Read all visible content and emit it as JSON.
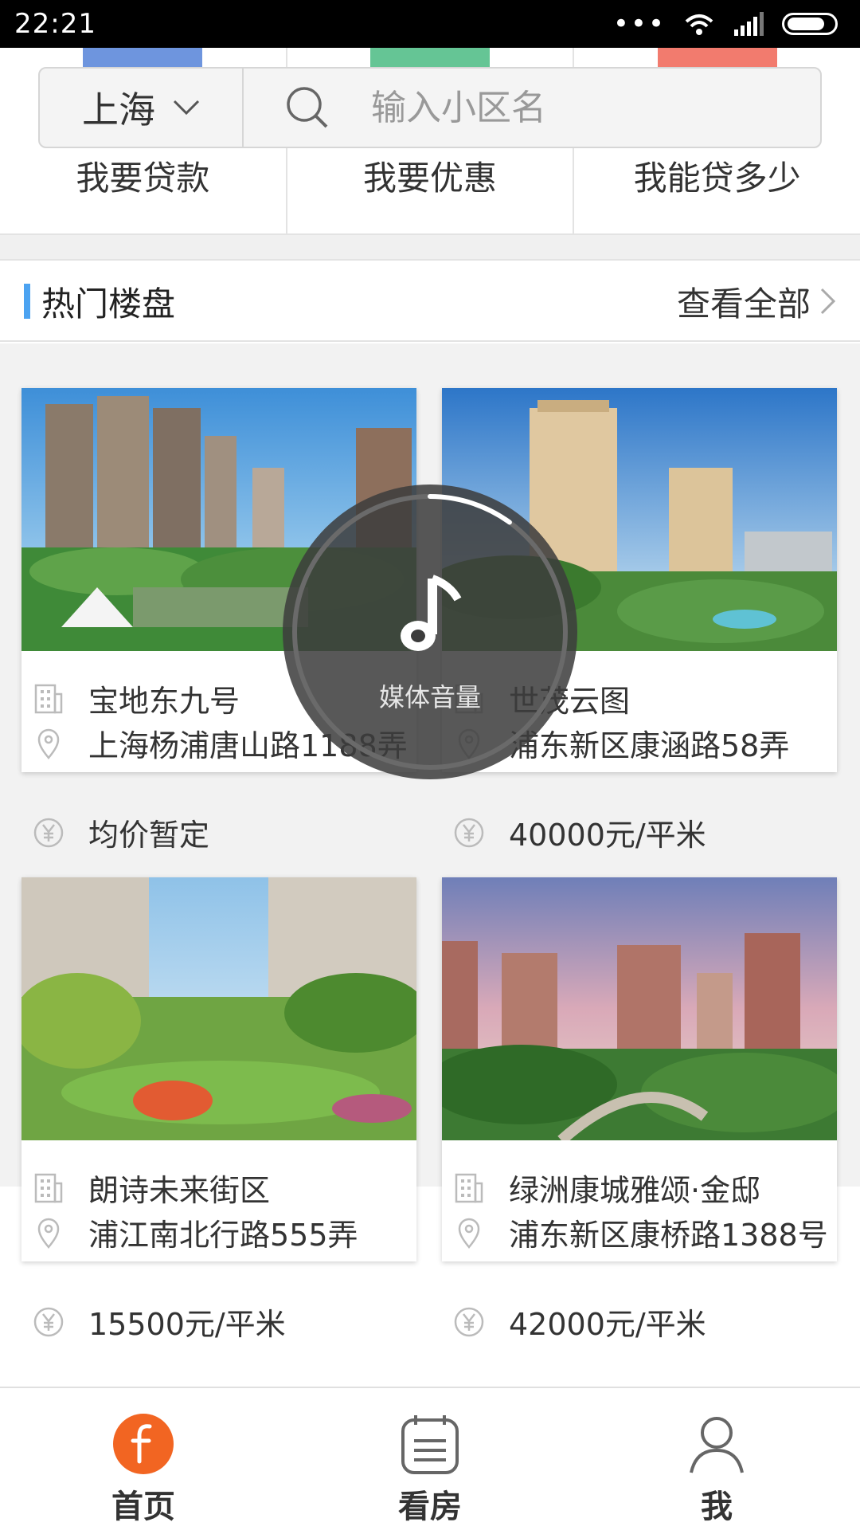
{
  "status_bar": {
    "time": "22:21",
    "dots": "•••"
  },
  "search": {
    "city": "上海",
    "placeholder": "输入小区名"
  },
  "features": [
    {
      "label": "我要贷款"
    },
    {
      "label": "我要优惠"
    },
    {
      "label": "我能贷多少"
    }
  ],
  "section": {
    "title": "热门楼盘",
    "view_all": "查看全部"
  },
  "listings": [
    {
      "name": "宝地东九号",
      "address": "上海杨浦唐山路1188弄",
      "price": "均价暂定"
    },
    {
      "name": "世茂云图",
      "address": "浦东新区康涵路58弄",
      "price": "40000元/平米"
    },
    {
      "name": "朗诗未来街区",
      "address": "浦江南北行路555弄",
      "price": "15500元/平米"
    },
    {
      "name": "绿洲康城雅颂·金邸",
      "address": "浦东新区康桥路1388号",
      "price": "42000元/平米"
    }
  ],
  "nav": [
    {
      "label": "首页",
      "icon": "home-logo-icon",
      "active": true
    },
    {
      "label": "看房",
      "icon": "calendar-list-icon"
    },
    {
      "label": "我",
      "icon": "user-icon"
    }
  ],
  "volume_overlay": {
    "label": "媒体音量",
    "level": 0.1
  },
  "colors": {
    "accent": "#4ca3f1",
    "brand_orange": "#f26522"
  }
}
